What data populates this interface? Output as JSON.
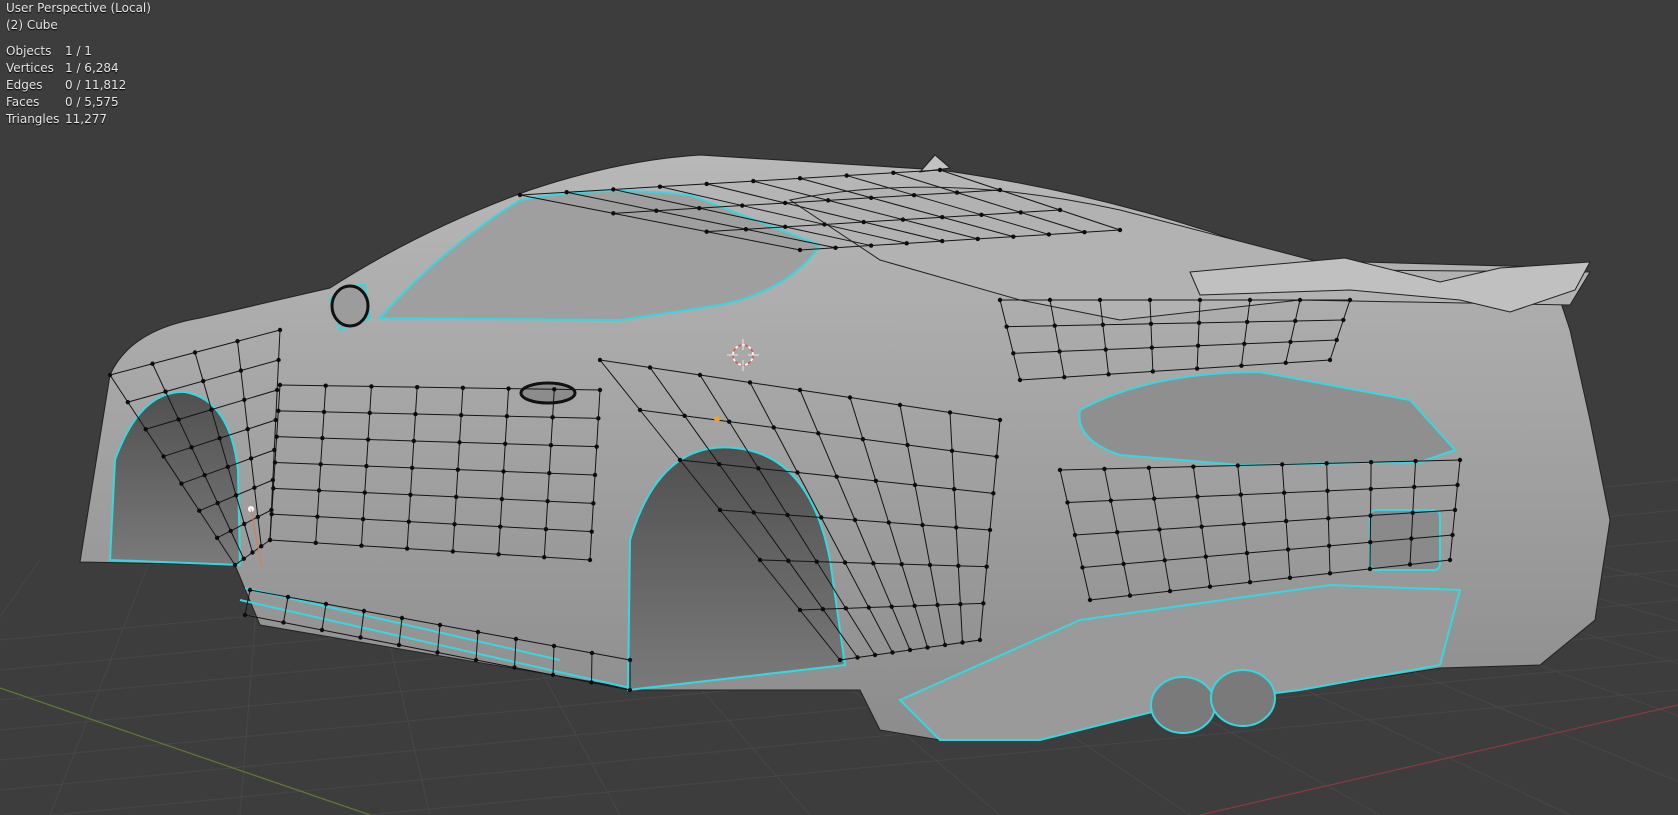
{
  "viewport": {
    "view_name": "User Perspective (Local)",
    "active_object": "(2) Cube"
  },
  "stats": [
    {
      "label": "Objects",
      "value": "1 / 1"
    },
    {
      "label": "Vertices",
      "value": "1 / 6,284"
    },
    {
      "label": "Edges",
      "value": "0 / 11,812"
    },
    {
      "label": "Faces",
      "value": "0 / 5,575"
    },
    {
      "label": "Triangles",
      "value": "11,277"
    }
  ],
  "colors": {
    "background": "#3d3d3d",
    "grid": "#4a4a4a",
    "x_axis": "#8a3a42",
    "y_axis": "#5e7a33",
    "mesh_fill": "#a9a9a9",
    "mesh_dark": "#5c5c5c",
    "wire": "#111111",
    "seam": "#35d8e0",
    "cursor": "#e05a4a",
    "selected_vertex": "#f0a030"
  },
  "icons": {
    "cursor": "3d-cursor-icon",
    "origin": "object-origin-icon"
  }
}
